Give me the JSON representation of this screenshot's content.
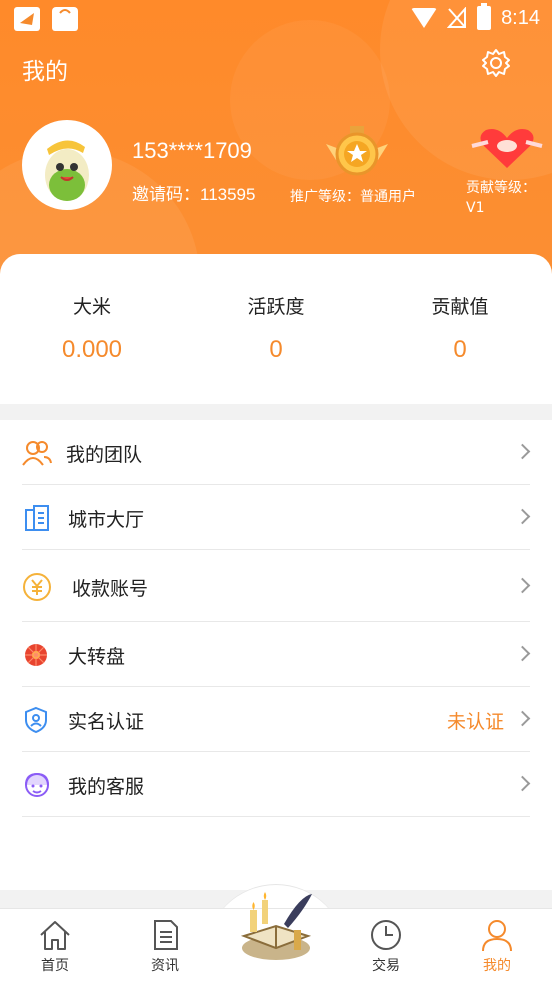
{
  "status_bar": {
    "time": "8:14"
  },
  "header": {
    "title": "我的",
    "phone": "153****1709",
    "invite_label": "邀请码：",
    "invite_code": "113595",
    "promotion_level": "推广等级：普通用户",
    "contribution_level": "贡献等级：V1"
  },
  "stats": [
    {
      "label": "大米",
      "value": "0.000"
    },
    {
      "label": "活跃度",
      "value": "0"
    },
    {
      "label": "贡献值",
      "value": "0"
    }
  ],
  "menu": [
    {
      "label": "我的团队",
      "icon": "team-icon"
    },
    {
      "label": "城市大厅",
      "icon": "building-icon"
    },
    {
      "label": "收款账号",
      "icon": "yuan-icon"
    },
    {
      "label": "大转盘",
      "icon": "wheel-icon"
    },
    {
      "label": "实名认证",
      "icon": "shield-icon",
      "status": "未认证"
    },
    {
      "label": "我的客服",
      "icon": "service-icon"
    }
  ],
  "nav": {
    "home": "首页",
    "news": "资讯",
    "trade": "交易",
    "mine": "我的"
  },
  "colors": {
    "accent": "#f58a2c",
    "header": "#ff8a2a"
  }
}
